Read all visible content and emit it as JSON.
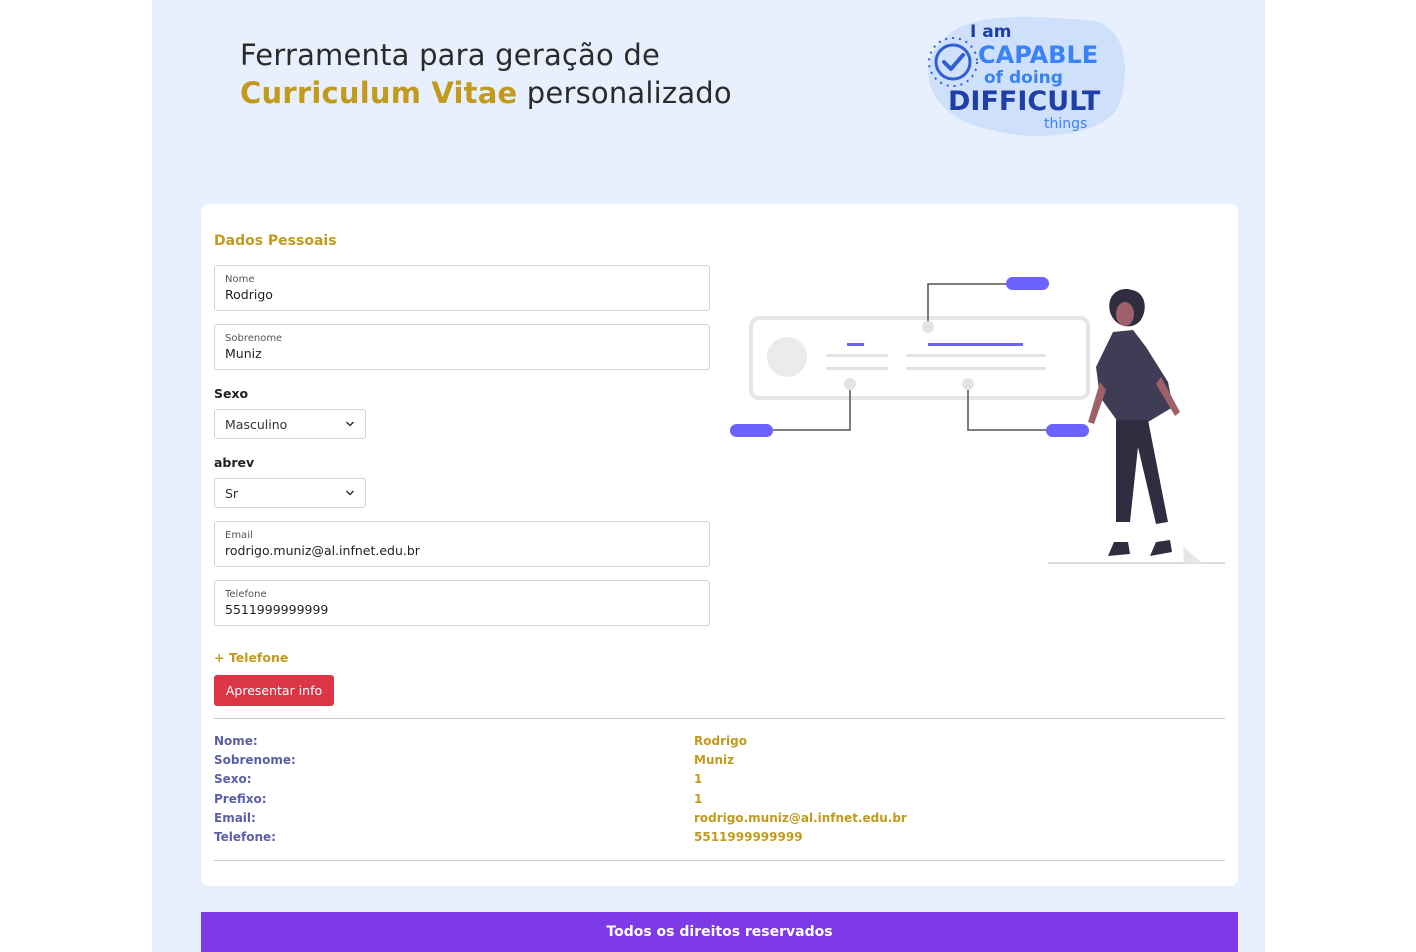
{
  "header": {
    "title_line1": "Ferramenta para geração de",
    "title_accent": "Curriculum Vitae",
    "title_rest": " personalizado"
  },
  "logo": {
    "line1": "I am",
    "line2": "CAPABLE",
    "line3": "of doing",
    "line4": "DIFFICULT",
    "line5": "things",
    "icon": "check-badge-icon"
  },
  "form": {
    "section_title": "Dados Pessoais",
    "nome": {
      "label": "Nome",
      "value": "Rodrigo"
    },
    "sobrenome": {
      "label": "Sobrenome",
      "value": "Muniz"
    },
    "sexo": {
      "label": "Sexo",
      "selected": "Masculino"
    },
    "abrev": {
      "label": "abrev",
      "selected": "Sr"
    },
    "email": {
      "label": "Email",
      "value": "rodrigo.muniz@al.infnet.edu.br"
    },
    "telefone": {
      "label": "Telefone",
      "value": "5511999999999"
    },
    "add_phone": "+ Telefone",
    "submit": "Apresentar info"
  },
  "summary": [
    {
      "key": "Nome:",
      "value": "Rodrigo"
    },
    {
      "key": "Sobrenome:",
      "value": "Muniz"
    },
    {
      "key": "Sexo:",
      "value": "1"
    },
    {
      "key": "Prefixo:",
      "value": "1"
    },
    {
      "key": "Email:",
      "value": "rodrigo.muniz@al.infnet.edu.br"
    },
    {
      "key": "Telefone:",
      "value": "5511999999999"
    }
  ],
  "footer": {
    "text": "Todos os direitos reservados"
  },
  "colors": {
    "accent": "#c19a1e",
    "button": "#dc3545",
    "footer": "#7e3ae6",
    "background": "#e8f0fe",
    "key_text": "#5b5fa8"
  }
}
